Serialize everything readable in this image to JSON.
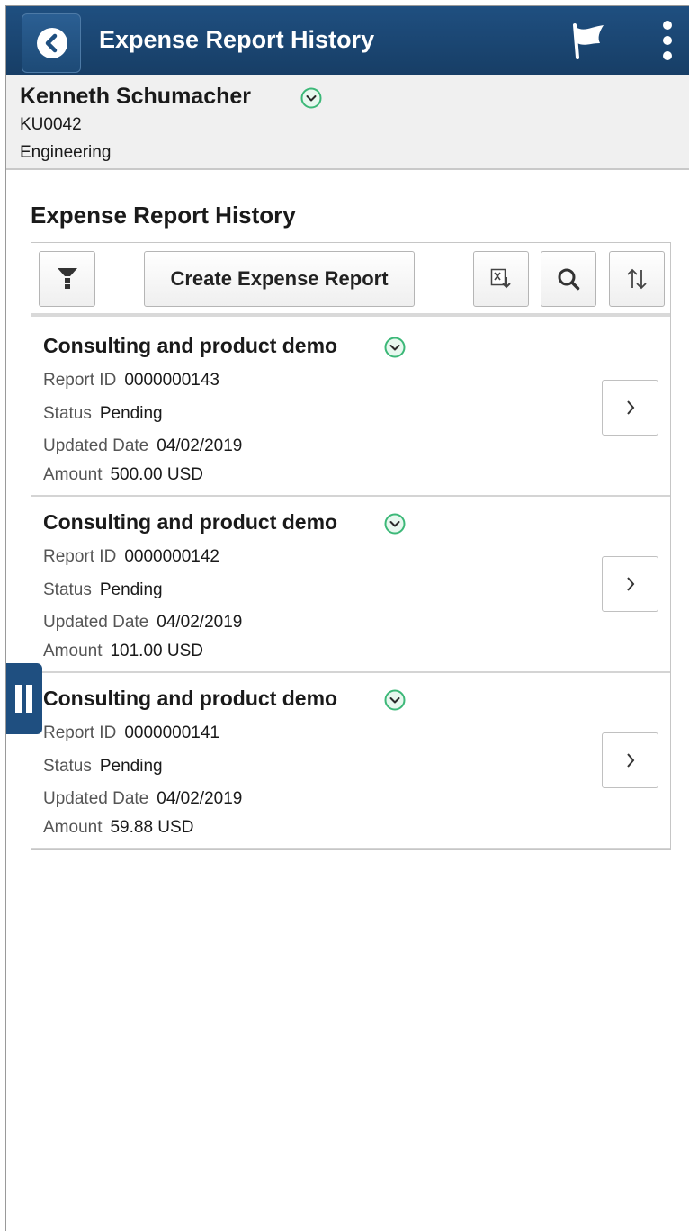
{
  "header": {
    "title": "Expense Report History"
  },
  "employee": {
    "name": "Kenneth Schumacher",
    "id": "KU0042",
    "department": "Engineering"
  },
  "section": {
    "title": "Expense Report History"
  },
  "toolbar": {
    "create_label": "Create Expense Report",
    "icons": [
      "filter-icon",
      "excel-export-icon",
      "search-icon",
      "sort-icon"
    ]
  },
  "labels": {
    "report_id": "Report ID",
    "status": "Status",
    "updated_date": "Updated Date",
    "amount": "Amount"
  },
  "reports": [
    {
      "title": "Consulting and product demo",
      "report_id": "0000000143",
      "status": "Pending",
      "updated_date": "04/02/2019",
      "amount": "500.00 USD"
    },
    {
      "title": "Consulting and product demo",
      "report_id": "0000000142",
      "status": "Pending",
      "updated_date": "04/02/2019",
      "amount": "101.00 USD"
    },
    {
      "title": "Consulting and product demo",
      "report_id": "0000000141",
      "status": "Pending",
      "updated_date": "04/02/2019",
      "amount": "59.88 USD"
    }
  ],
  "colors": {
    "header_bg": "#1f4f80",
    "chevron_green": "#3cb878",
    "employee_bar_bg": "#f0f0f0"
  }
}
